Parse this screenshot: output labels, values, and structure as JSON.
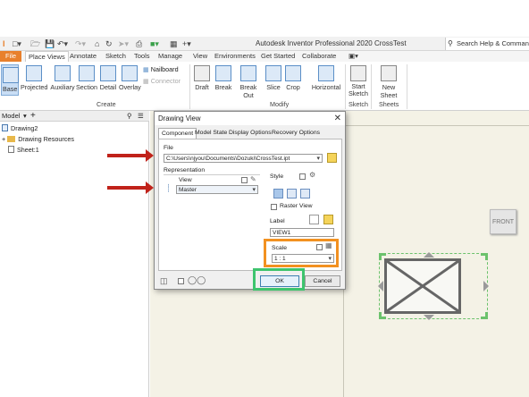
{
  "window": {
    "title": "Autodesk Inventor Professional 2020    CrossTest",
    "search_placeholder": "Search Help & Commands..."
  },
  "ribbon_tabs": [
    "File",
    "Place Views",
    "Annotate",
    "Sketch",
    "Tools",
    "Manage",
    "View",
    "Environments",
    "Get Started",
    "Collaborate"
  ],
  "ribbon": {
    "create": {
      "label": "Create",
      "buttons": [
        "Base",
        "Projected",
        "Auxiliary",
        "Section",
        "Detail",
        "Overlay"
      ],
      "small_buttons": [
        "Nailboard",
        "Connector"
      ]
    },
    "modify": {
      "label": "Modify",
      "buttons": [
        "Draft",
        "Break",
        "Break Out",
        "Slice",
        "Crop",
        "Horizontal"
      ]
    },
    "sketch": {
      "label": "Sketch",
      "buttons": [
        "Start Sketch"
      ]
    },
    "sheets": {
      "label": "Sheets",
      "buttons": [
        "New Sheet"
      ]
    }
  },
  "browser": {
    "title": "Model",
    "items": [
      "Drawing2",
      "Drawing Resources",
      "Sheet:1"
    ]
  },
  "dialog": {
    "title": "Drawing View",
    "tabs": [
      "Component",
      "Model State",
      "Display Options",
      "Recovery Options"
    ],
    "file_label": "File",
    "file_path": "C:\\Users\\njyou\\Documents\\Dozuki\\CrossTest.ipt",
    "representation_label": "Representation",
    "view_label": "View",
    "view_value": "Master",
    "style_label": "Style",
    "raster_view_label": "Raster View",
    "label_label": "Label",
    "label_value": "VIEW1",
    "scale_label": "Scale",
    "scale_value": "1 : 1",
    "ok_label": "OK",
    "cancel_label": "Cancel"
  },
  "viewcube_label": "FRONT",
  "colors": {
    "file_tab": "#e8802c",
    "annotation_arrow": "#c0221a",
    "highlight_scale": "#f29121",
    "highlight_ok": "#3ec46e",
    "sheet_background": "#f4f2e6"
  }
}
